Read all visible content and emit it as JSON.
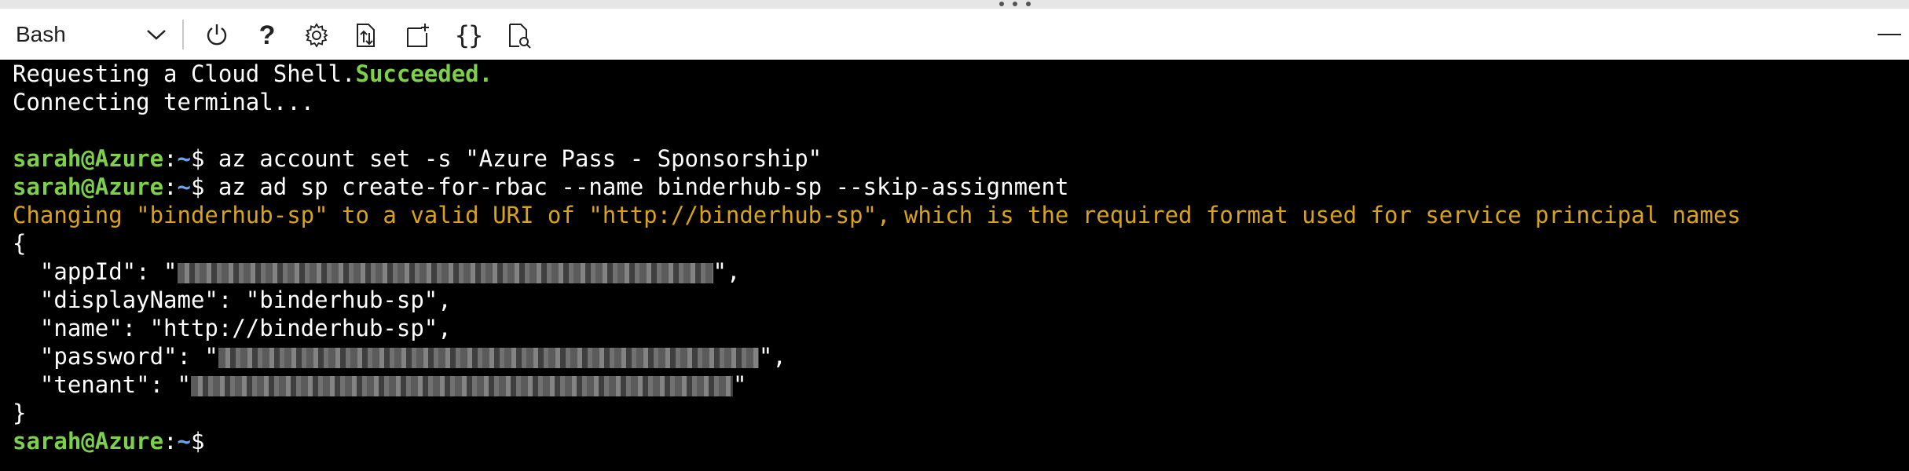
{
  "toolbar": {
    "shell_label": "Bash",
    "icons": [
      "power-icon",
      "help-icon",
      "settings-icon",
      "upload-download-icon",
      "new-session-icon",
      "editor-braces-icon",
      "web-preview-icon"
    ],
    "help_glyph": "?",
    "braces_glyph": "{}"
  },
  "terminal": {
    "line1": {
      "text": "Requesting a Cloud Shell.",
      "status": "Succeeded."
    },
    "line2": "Connecting terminal...",
    "prompt": {
      "user": "sarah@Azure",
      "colon": ":",
      "path": "~",
      "dollar": "$"
    },
    "cmd1": " az account set -s \"Azure Pass - Sponsorship\"",
    "cmd2": " az ad sp create-for-rbac --name binderhub-sp --skip-assignment",
    "warning": "Changing \"binderhub-sp\" to a valid URI of \"http://binderhub-sp\", which is the required format used for service principal names",
    "json": {
      "open": "{",
      "appId_key": "  \"appId\": \"",
      "appId_end": "\",",
      "displayName": "  \"displayName\": \"binderhub-sp\",",
      "name": "  \"name\": \"http://binderhub-sp\",",
      "password_key": "  \"password\": \"",
      "password_end": "\",",
      "tenant_key": "  \"tenant\": \"",
      "tenant_end": "\"",
      "close": "}"
    }
  },
  "colors": {
    "success": "#7dd04a",
    "path": "#6aa6f5",
    "warning": "#d9a21b",
    "background": "#000000"
  }
}
